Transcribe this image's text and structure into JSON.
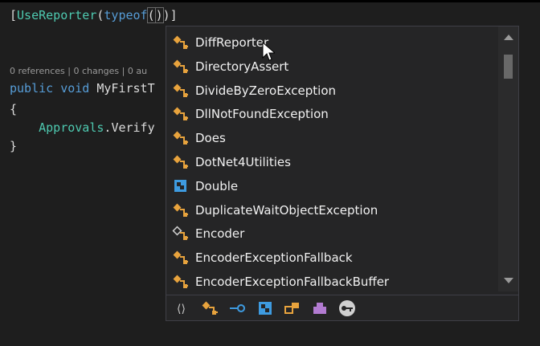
{
  "editor": {
    "attr_open": "[",
    "attr_name": "UseReporter",
    "attr_paren": "(",
    "typeof_kw": "typeof",
    "paren_open": "(",
    "paren_close": ")",
    "attr_close": ")]",
    "codelens": "0 references | 0 changes | 0 au",
    "line_public": "public",
    "line_void": "void",
    "method": "MyFirstT",
    "brace_open": "{",
    "approvals": "Approvals",
    "dot": ".",
    "verify": "Verify",
    "brace_close": "}"
  },
  "completion": {
    "items": [
      {
        "label": "DiffReporter",
        "icon": "class-icon"
      },
      {
        "label": "DirectoryAssert",
        "icon": "class-icon"
      },
      {
        "label": "DivideByZeroException",
        "icon": "class-icon"
      },
      {
        "label": "DllNotFoundException",
        "icon": "class-icon"
      },
      {
        "label": "Does",
        "icon": "class-icon"
      },
      {
        "label": "DotNet4Utilities",
        "icon": "class-icon"
      },
      {
        "label": "Double",
        "icon": "struct-icon"
      },
      {
        "label": "DuplicateWaitObjectException",
        "icon": "class-icon"
      },
      {
        "label": "Encoder",
        "icon": "abstract-class-icon"
      },
      {
        "label": "EncoderExceptionFallback",
        "icon": "class-icon"
      },
      {
        "label": "EncoderExceptionFallbackBuffer",
        "icon": "class-icon"
      }
    ],
    "filters": [
      {
        "name": "namespace-filter-icon",
        "glyph": "⟨⟩"
      },
      {
        "name": "class-filter-icon",
        "glyph": "class"
      },
      {
        "name": "interface-filter-icon",
        "glyph": "interface"
      },
      {
        "name": "struct-filter-icon",
        "glyph": "struct"
      },
      {
        "name": "enum-filter-icon",
        "glyph": "enum"
      },
      {
        "name": "delegate-filter-icon",
        "glyph": "delegate"
      },
      {
        "name": "keyword-filter-icon",
        "glyph": "keyword"
      }
    ],
    "colors": {
      "class": "#e8a33d",
      "struct": "#3e9be0",
      "interface": "#3e9be0",
      "delegate": "#b27bd1"
    }
  }
}
